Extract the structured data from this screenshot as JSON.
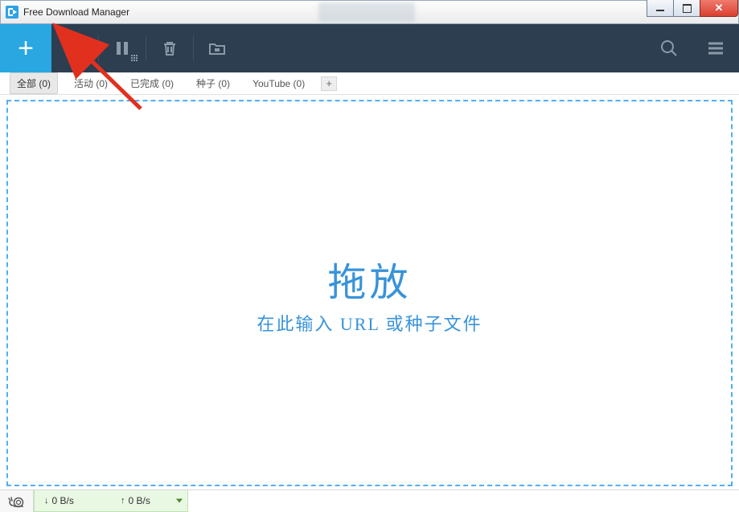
{
  "window": {
    "title": "Free Download Manager"
  },
  "toolbar": {
    "add": "+",
    "addtab": "+"
  },
  "tabs": [
    {
      "label": "全部 (0)",
      "active": true
    },
    {
      "label": "活动 (0)",
      "active": false
    },
    {
      "label": "已完成 (0)",
      "active": false
    },
    {
      "label": "种子 (0)",
      "active": false
    },
    {
      "label": "YouTube (0)",
      "active": false
    }
  ],
  "drop": {
    "title": "拖放",
    "subtitle": "在此输入 URL 或种子文件"
  },
  "status": {
    "down_prefix": "↓",
    "down_value": "0 B/s",
    "up_prefix": "↑",
    "up_value": "0 B/s"
  }
}
